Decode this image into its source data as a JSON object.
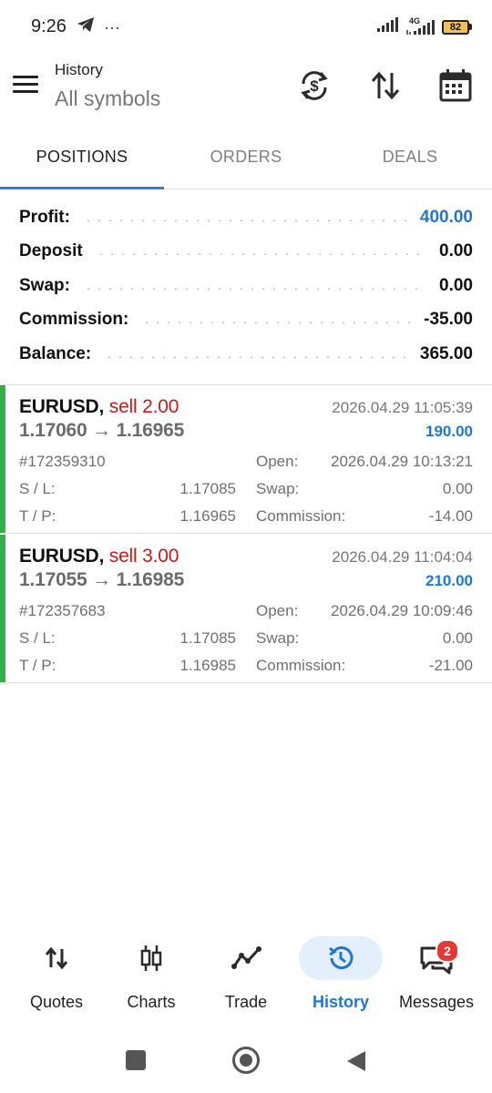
{
  "status_bar": {
    "time": "9:26",
    "dots": "···",
    "network": "4G",
    "battery": "82"
  },
  "header": {
    "title": "History",
    "subtitle": "All symbols"
  },
  "tabs": [
    {
      "label": "POSITIONS",
      "active": true
    },
    {
      "label": "ORDERS",
      "active": false
    },
    {
      "label": "DEALS",
      "active": false
    }
  ],
  "summary": [
    {
      "label": "Profit:",
      "value": "400.00"
    },
    {
      "label": "Deposit",
      "value": "0.00"
    },
    {
      "label": "Swap:",
      "value": "0.00"
    },
    {
      "label": "Commission:",
      "value": "-35.00"
    },
    {
      "label": "Balance:",
      "value": "365.00"
    }
  ],
  "positions": [
    {
      "symbol": "EURUSD,",
      "side": "sell 2.00",
      "prices": "1.17060 → 1.16965",
      "close_time": "2026.04.29 11:05:39",
      "profit": "190.00",
      "ticket": "#172359310",
      "open_label": "Open:",
      "open_time": "2026.04.29 10:13:21",
      "sl_label": "S / L:",
      "sl": "1.17085",
      "swap_label": "Swap:",
      "swap": "0.00",
      "tp_label": "T / P:",
      "tp": "1.16965",
      "commission_label": "Commission:",
      "commission": "-14.00"
    },
    {
      "symbol": "EURUSD,",
      "side": "sell 3.00",
      "prices": "1.17055 → 1.16985",
      "close_time": "2026.04.29 11:04:04",
      "profit": "210.00",
      "ticket": "#172357683",
      "open_label": "Open:",
      "open_time": "2026.04.29 10:09:46",
      "sl_label": "S / L:",
      "sl": "1.17085",
      "swap_label": "Swap:",
      "swap": "0.00",
      "tp_label": "T / P:",
      "tp": "1.16985",
      "commission_label": "Commission:",
      "commission": "-21.00"
    }
  ],
  "bottom_nav": [
    {
      "label": "Quotes",
      "icon": "quotes-arrows-icon",
      "active": false
    },
    {
      "label": "Charts",
      "icon": "candlestick-icon",
      "active": false
    },
    {
      "label": "Trade",
      "icon": "trade-line-icon",
      "active": false
    },
    {
      "label": "History",
      "icon": "history-clock-icon",
      "active": true
    },
    {
      "label": "Messages",
      "icon": "messages-icon",
      "active": false,
      "badge": "2"
    }
  ],
  "colors": {
    "accent": "#1f77d0",
    "sell": "#c51a1a",
    "position_bar": "#34b04a",
    "badge": "#e53935",
    "active_nav_bg": "#e3effb"
  }
}
